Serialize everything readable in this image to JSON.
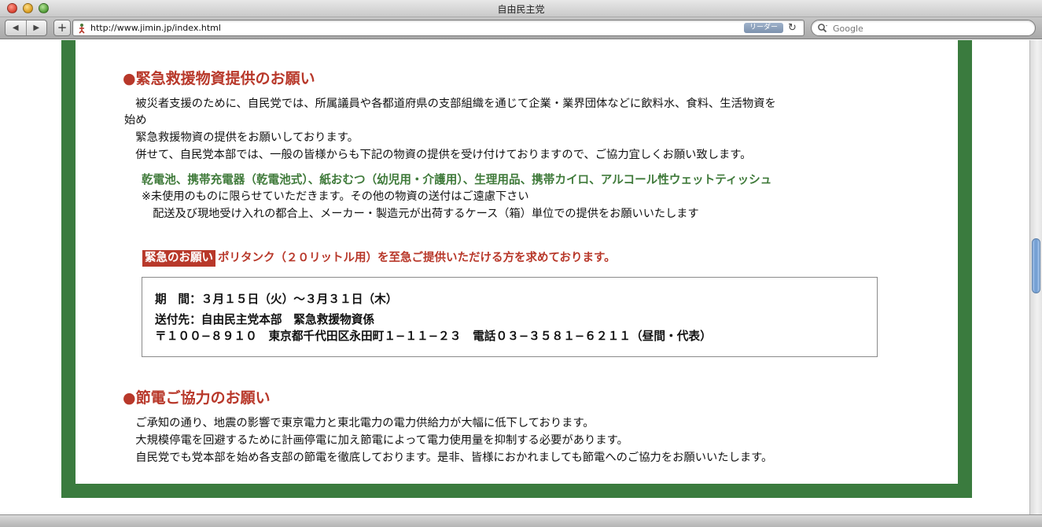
{
  "window": {
    "title": "自由民主党"
  },
  "toolbar": {
    "back_icon": "◀",
    "forward_icon": "▶",
    "add_icon": "+",
    "url": "http://www.jimin.jp/index.html",
    "reader_label": "リーダー",
    "reload_icon": "↻",
    "search_placeholder": "Google"
  },
  "colors": {
    "frame_green": "#3a7b3e",
    "heading_red": "#b8382a",
    "goods_green": "#3f7a3a"
  },
  "section1": {
    "heading": "●緊急救援物資提供のお願い",
    "lines": [
      "　被災者支援のために、自民党では、所属議員や各都道府県の支部組織を通じて企業・業界団体などに飲料水、食料、生活物資を",
      "始め",
      "　緊急救援物資の提供をお願いしております。",
      "　併せて、自民党本部では、一般の皆様からも下記の物資の提供を受け付けておりますので、ご協力宜しくお願い致します。"
    ],
    "goods": "乾電池、携帯充電器（乾電池式）、紙おむつ（幼児用・介護用）、生理用品、携帯カイロ、アルコール性ウェットティッシュ",
    "note1": "※未使用のものに限らせていただきます。その他の物資の送付はご遠慮下さい",
    "note2": "　配送及び現地受け入れの都合上、メーカー・製造元が出荷するケース（箱）単位での提供をお願いいたします",
    "urgent_badge": "緊急のお願い",
    "urgent_text": "ポリタンク（２０リットル用）を至急ご提供いただける方を求めております。",
    "info": {
      "period": "期　間：３月１５日（火）〜３月３１日（木）",
      "dest": "送付先：自由民主党本部　緊急救援物資係",
      "address": "〒１００−８９１０　東京都千代田区永田町１−１１−２３　電話０３−３５８１−６２１１（昼間・代表）"
    }
  },
  "section2": {
    "heading": "●節電ご協力のお願い",
    "lines": [
      "　ご承知の通り、地震の影響で東京電力と東北電力の電力供給力が大幅に低下しております。",
      "　大規模停電を回避するために計画停電に加え節電によって電力使用量を抑制する必要があります。",
      "　自民党でも党本部を始め各支部の節電を徹底しております。是非、皆様におかれましても節電へのご協力をお願いいたします。"
    ]
  }
}
